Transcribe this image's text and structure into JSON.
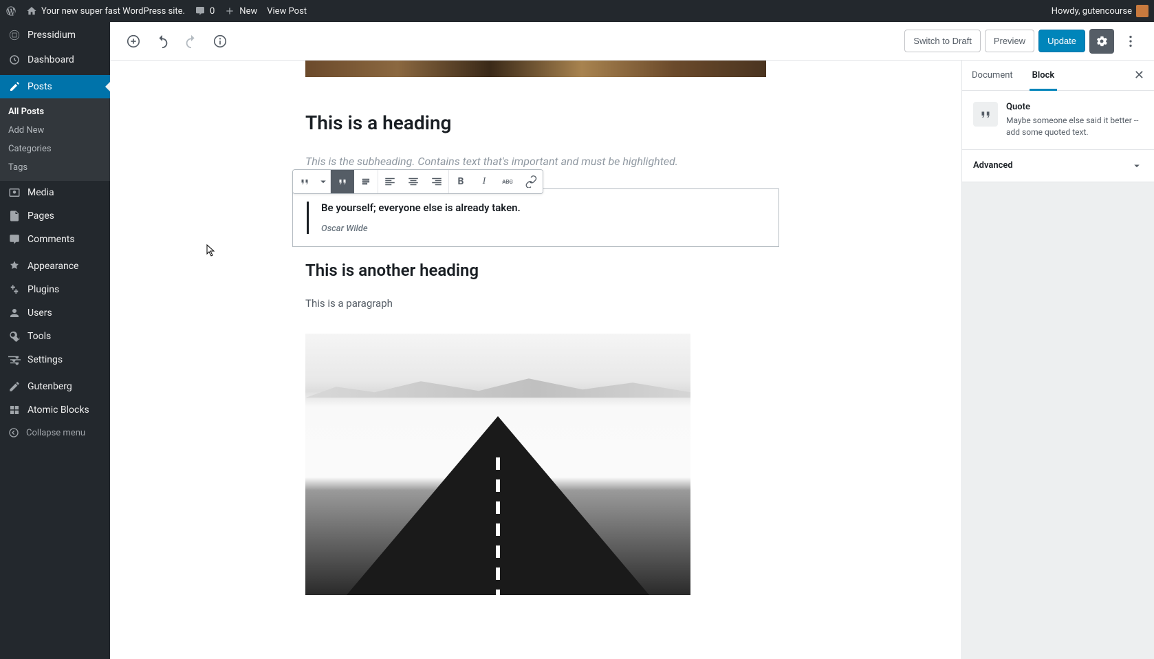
{
  "admin_bar": {
    "site_title": "Your new super fast WordPress site.",
    "comments_count": "0",
    "new_label": "New",
    "view_post_label": "View Post",
    "howdy": "Howdy, gutencourse"
  },
  "sidebar": {
    "brand": "Pressidium",
    "items": [
      {
        "label": "Dashboard"
      },
      {
        "label": "Posts"
      },
      {
        "label": "Media"
      },
      {
        "label": "Pages"
      },
      {
        "label": "Comments"
      },
      {
        "label": "Appearance"
      },
      {
        "label": "Plugins"
      },
      {
        "label": "Users"
      },
      {
        "label": "Tools"
      },
      {
        "label": "Settings"
      },
      {
        "label": "Gutenberg"
      },
      {
        "label": "Atomic Blocks"
      }
    ],
    "posts_submenu": [
      {
        "label": "All Posts"
      },
      {
        "label": "Add New"
      },
      {
        "label": "Categories"
      },
      {
        "label": "Tags"
      }
    ],
    "collapse_label": "Collapse menu"
  },
  "editor_header": {
    "switch_to_draft": "Switch to Draft",
    "preview": "Preview",
    "update": "Update"
  },
  "content": {
    "heading1": "This is a heading",
    "subheading": "This is the subheading. Contains text that's important and must be highlighted.",
    "quote_text": "Be yourself; everyone else is already taken.",
    "quote_cite": "Oscar Wilde",
    "heading2": "This is another heading",
    "paragraph": "This is a paragraph"
  },
  "inspector": {
    "tabs": {
      "document": "Document",
      "block": "Block"
    },
    "block_name": "Quote",
    "block_desc": "Maybe someone else said it better -- add some quoted text.",
    "advanced_label": "Advanced"
  }
}
